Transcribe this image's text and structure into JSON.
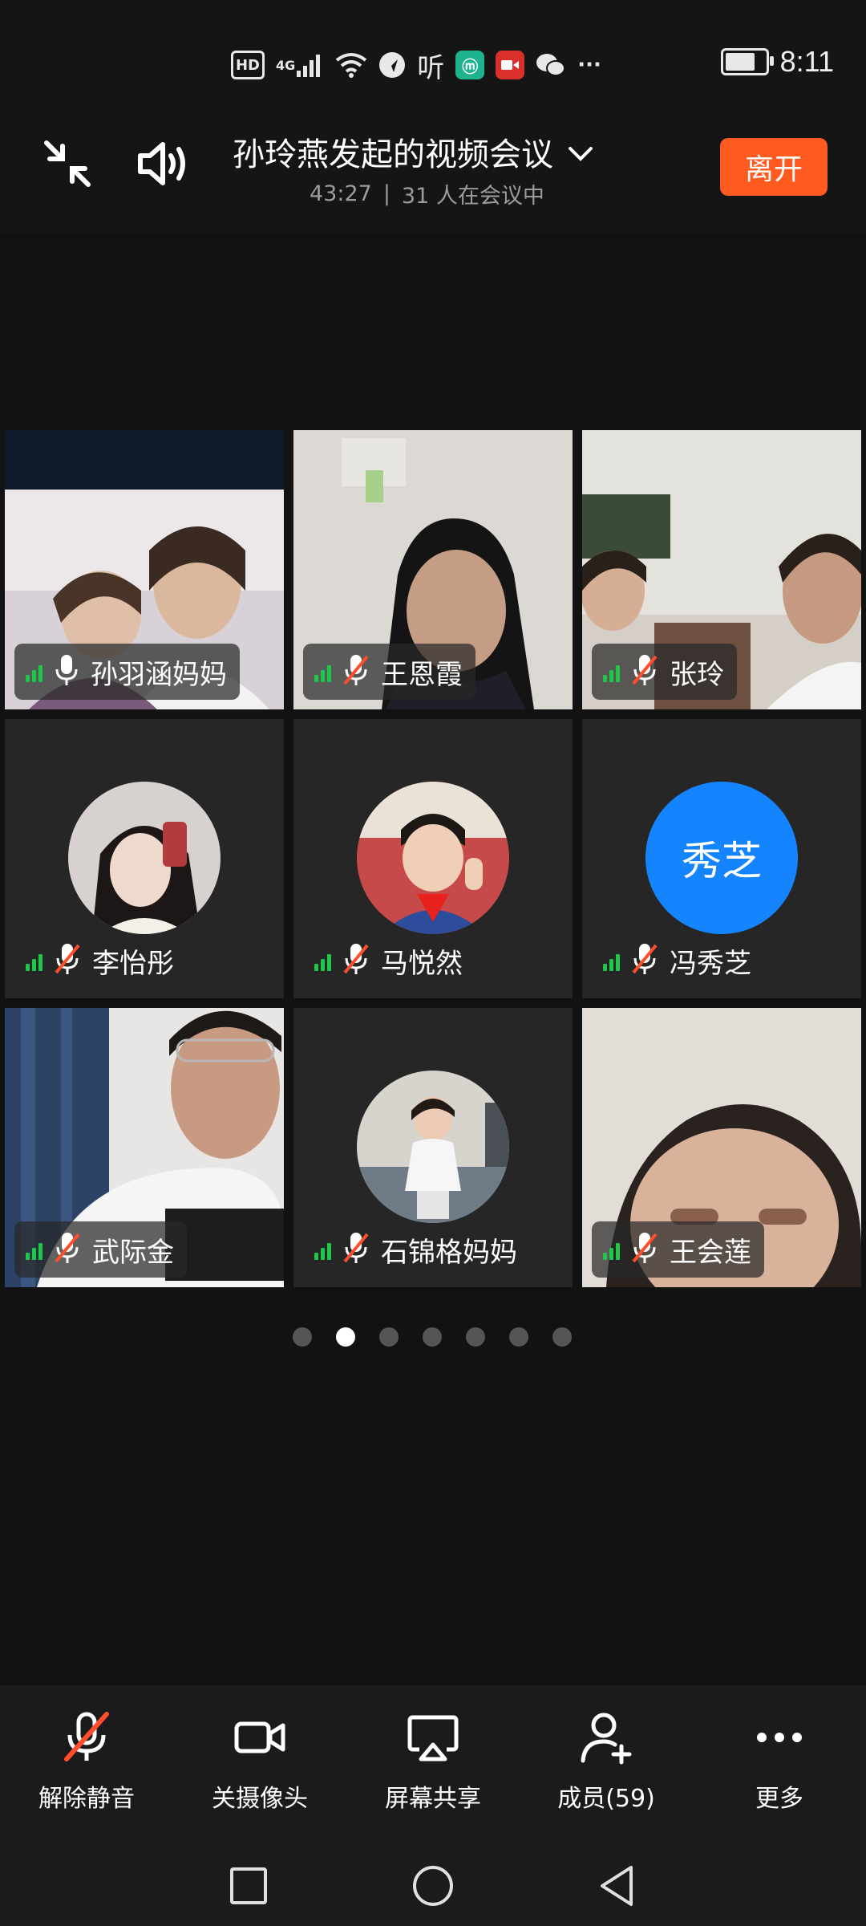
{
  "status_bar": {
    "hd": "HD",
    "network": "4G",
    "listen": "听",
    "mi": "ⓜ",
    "more": "···",
    "time": "8:11"
  },
  "header": {
    "title": "孙玲燕发起的视频会议",
    "duration": "43:27",
    "separator": "|",
    "participants_text": "31 人在会议中",
    "leave_label": "离开"
  },
  "participants": [
    {
      "name": "孙羽涵妈妈",
      "mic": "on",
      "video": true,
      "active": true
    },
    {
      "name": "王恩霞",
      "mic": "muted",
      "video": true
    },
    {
      "name": "张玲",
      "mic": "muted",
      "video": true
    },
    {
      "name": "李怡彤",
      "mic": "muted",
      "video": false,
      "avatar": "photo"
    },
    {
      "name": "马悦然",
      "mic": "muted",
      "video": false,
      "avatar": "photo"
    },
    {
      "name": "冯秀芝",
      "mic": "muted",
      "video": false,
      "avatar_text": "秀芝"
    },
    {
      "name": "武际金",
      "mic": "muted",
      "video": true
    },
    {
      "name": "石锦格妈妈",
      "mic": "muted",
      "video": false,
      "avatar": "photo"
    },
    {
      "name": "王会莲",
      "mic": "muted",
      "video": true
    }
  ],
  "pagination": {
    "total": 7,
    "current": 2
  },
  "toolbar": {
    "unmute": "解除静音",
    "camera_off": "关摄像头",
    "screen_share": "屏幕共享",
    "members": "成员(59)",
    "more": "更多"
  },
  "colors": {
    "accent_orange": "#ff5a1f",
    "active_green": "#1ec64c",
    "mute_red": "#ff4d2e",
    "avatar_blue": "#1584ff"
  }
}
